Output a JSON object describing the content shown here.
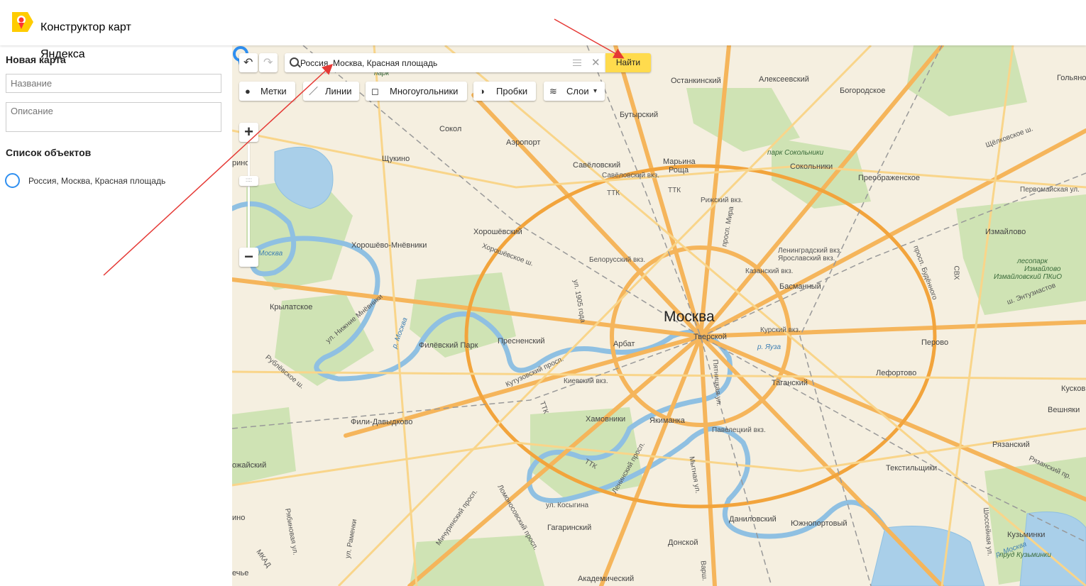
{
  "header": {
    "brand_line1": "Конструктор карт",
    "brand_line2": "Яндекса",
    "brand_color": "#ffcc00",
    "logo_icon": "yandex-maps-logo-icon"
  },
  "sidebar": {
    "title": "Новая карта",
    "name_placeholder": "Название",
    "description_placeholder": "Описание",
    "objects_title": "Список объектов",
    "objects": [
      {
        "label": "Россия, Москва, Красная площадь",
        "icon": "circle-outline-icon",
        "color": "#2f8ff0"
      }
    ]
  },
  "map": {
    "controls": {
      "undo_icon": "undo-icon",
      "redo_icon": "redo-icon",
      "search_value": "Россия, Москва, Красная площадь",
      "find_label": "Найти",
      "find_color": "#ffdb4d",
      "tools": [
        {
          "label": "Метки",
          "icon": "placemark-icon"
        },
        {
          "label": "Линии",
          "icon": "line-icon"
        },
        {
          "label": "Многоугольники",
          "icon": "polygon-icon"
        },
        {
          "label": "Пробки",
          "icon": "traffic-icon"
        },
        {
          "label": "Слои",
          "icon": "layers-icon"
        }
      ],
      "zoom_in": "+",
      "zoom_out": "−"
    },
    "city_label": "Москва",
    "labels": {
      "ostankinsky": "Останкинский",
      "alekseevsky": "Алексеевский",
      "bogorodskoe": "Богородское",
      "golyanovo": "Гольянов",
      "butyrsky": "Бутырский",
      "sokol": "Сокол",
      "aeroport": "Аэропорт",
      "savelovsky": "Савёловский",
      "savelovsky_vkz": "Савёловский вкз.",
      "maryina": "Марьина",
      "roshcha": "Роща",
      "pr_mira": "просп. Мира",
      "park_sokolniki": "парк Сокольники",
      "sokolniki": "Сокольники",
      "preobrazhenskoe": "Преображенское",
      "schelkovskoe": "Щёлковское ш.",
      "pervomayskaya": "Первомайская ул.",
      "shchukino": "Щукино",
      "rizhsky_vkz": "Рижский вкз.",
      "ttk1": "ТТК",
      "ttk2": "ТТК",
      "khoroshevsky": "Хорошёвский",
      "khoroshevo": "Хорошёво-Мнёвники",
      "khoroshevskoe_sh": "Хорошёвское ш.",
      "belorussky_vkz": "Белорусский вкз.",
      "leningradsky_vkz": "Ленинградский вкз.",
      "yaroslavsky_vkz": "Ярославский вкз.",
      "kazansky_vkz": "Казанский вкз.",
      "izmaylovo": "Измайлово",
      "lesopark": "лесопарк",
      "izmaylovo2": "Измайлово",
      "izmaylovsky_pkio": "Измайловский ПКиО",
      "entuziastov": "ш. Энтузиастов",
      "basmanny": "Басманный",
      "moskva_river": "Москва",
      "krylatskoe": "Крылатское",
      "nizhnie_mnevniki": "ул. Нижние Мнёвники",
      "r_moskva": "р. Москва",
      "filevsky_park": "Филёвский Парк",
      "presnensky": "Пресненский",
      "ul_1905": "ул. 1905 года",
      "arbat": "Арбат",
      "tverskoy": "Тверской",
      "kursky_vkz": "Курский вкз.",
      "r_yauza": "р. Яуза",
      "perovo": "Перово",
      "lefortovo": "Лефортово",
      "kutuzovsky": "Кутузовский просп.",
      "kievsky_vkz": "Киевский вкз.",
      "rublevskoe": "Рублёвское ш.",
      "taganksy": "Таганский",
      "pyatnitskaya": "Пятницкая ул.",
      "kuskovo": "Кусков",
      "veshnyaki": "Вешняки",
      "fili": "Фили-Давыдково",
      "khamovniki": "Хамовники",
      "yakimanka": "Якиманка",
      "paveletsky": "Павелецкий вкз.",
      "ryazansky": "Рязанский",
      "ryazansky_pr": "Рязанский пр.",
      "mozhaysky": "ожайский",
      "leninsky": "Ленинский просп.",
      "mytnaya": "Мытная ул.",
      "tekstilshchiki": "Текстильщики",
      "kosygina": "ул. Косыгина",
      "michurinsky": "Мичуринский просп.",
      "lomonosovsky": "Ломоносовский просп.",
      "gagarinsky": "Гагаринский",
      "danilovsky": "Даниловский",
      "yuzhnoportovy": "Южнопортовый",
      "ryabinovaya": "Рябиновая ул.",
      "ramenka": "ул. Раменки",
      "kuzminki": "Кузьминки",
      "r_moskva2": "р. Москва",
      "r_kuzminki": "пруд Кузьминки",
      "donskoy": "Донской",
      "akademichesky": "Академический",
      "mkad": "МКАД",
      "varsh": "Варш.",
      "ochakovo": "ечье",
      "ttk3": "ТТК",
      "ttk4": "ТТК",
      "shosseynaya": "Шоссейная ул.",
      "budennogo": "просп. Будённого",
      "ino": "ино",
      "park_label": "парк",
      "ino2": "рино",
      "svh": "СВХ"
    }
  }
}
